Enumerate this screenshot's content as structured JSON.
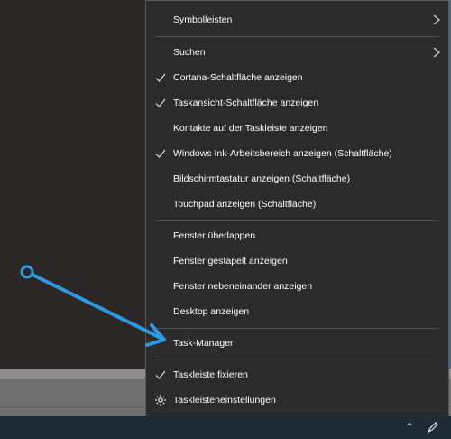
{
  "menu": {
    "items": [
      {
        "label": "Symbolleisten",
        "checked": false,
        "submenu": true
      },
      {
        "label": "Suchen",
        "checked": false,
        "submenu": true
      },
      {
        "label": "Cortana-Schaltfläche anzeigen",
        "checked": true
      },
      {
        "label": "Taskansicht-Schaltfläche anzeigen",
        "checked": true
      },
      {
        "label": "Kontakte auf der Taskleiste anzeigen",
        "checked": false
      },
      {
        "label": "Windows Ink-Arbeitsbereich anzeigen (Schaltfläche)",
        "checked": true
      },
      {
        "label": "Bildschirmtastatur anzeigen (Schaltfläche)",
        "checked": false
      },
      {
        "label": "Touchpad anzeigen (Schaltfläche)",
        "checked": false
      },
      {
        "label": "Fenster überlappen",
        "checked": false
      },
      {
        "label": "Fenster gestapelt anzeigen",
        "checked": false
      },
      {
        "label": "Fenster nebeneinander anzeigen",
        "checked": false
      },
      {
        "label": "Desktop anzeigen",
        "checked": false
      },
      {
        "label": "Task-Manager",
        "checked": false
      },
      {
        "label": "Taskleiste fixieren",
        "checked": true
      },
      {
        "label": "Taskleisteneinstellungen",
        "checked": false,
        "icon": "gear-icon"
      }
    ]
  },
  "annotation": {
    "type": "arrow",
    "color": "#2f9ae0",
    "points_to": "Task-Manager"
  },
  "tray": {
    "icons": [
      "chevron-up-icon",
      "pen-icon"
    ]
  },
  "colors": {
    "menu_bg": "#2b2b2b",
    "menu_text": "#ffffff",
    "separator": "#4f4f4f",
    "arrow": "#2f9ae0"
  }
}
